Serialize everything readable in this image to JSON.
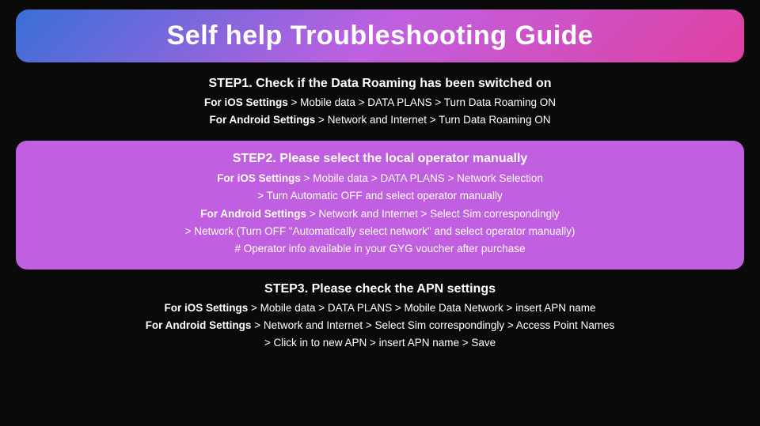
{
  "title": "Self help Troubleshooting Guide",
  "step1": {
    "title": "STEP1. Check if the Data Roaming has been switched on",
    "ios_line": "Mobile data > DATA PLANS > Turn Data Roaming ON",
    "android_line": "Network and Internet > Turn Data Roaming ON",
    "ios_label": "For iOS Settings",
    "android_label": "For Android Settings"
  },
  "step2": {
    "title": "STEP2. Please select the local operator manually",
    "ios_label": "For iOS Settings",
    "ios_line": "Mobile data > DATA PLANS > Network Selection",
    "ios_line2": "> Turn Automatic OFF and select operator manually",
    "android_label": "For Android Settings",
    "android_line": "Network and Internet > Select Sim correspondingly",
    "android_line2": "> Network (Turn OFF \"Automatically select network\" and select operator manually)",
    "note": "# Operator info available in your GYG voucher after purchase"
  },
  "step3": {
    "title": "STEP3. Please check the APN settings",
    "ios_label": "For iOS Settings",
    "ios_line": "Mobile data > DATA PLANS > Mobile Data Network > insert APN name",
    "android_label": "For Android Settings",
    "android_line": "Network and Internet > Select Sim correspondingly > Access Point Names",
    "android_line2": "> Click in to new APN > insert APN name > Save"
  }
}
